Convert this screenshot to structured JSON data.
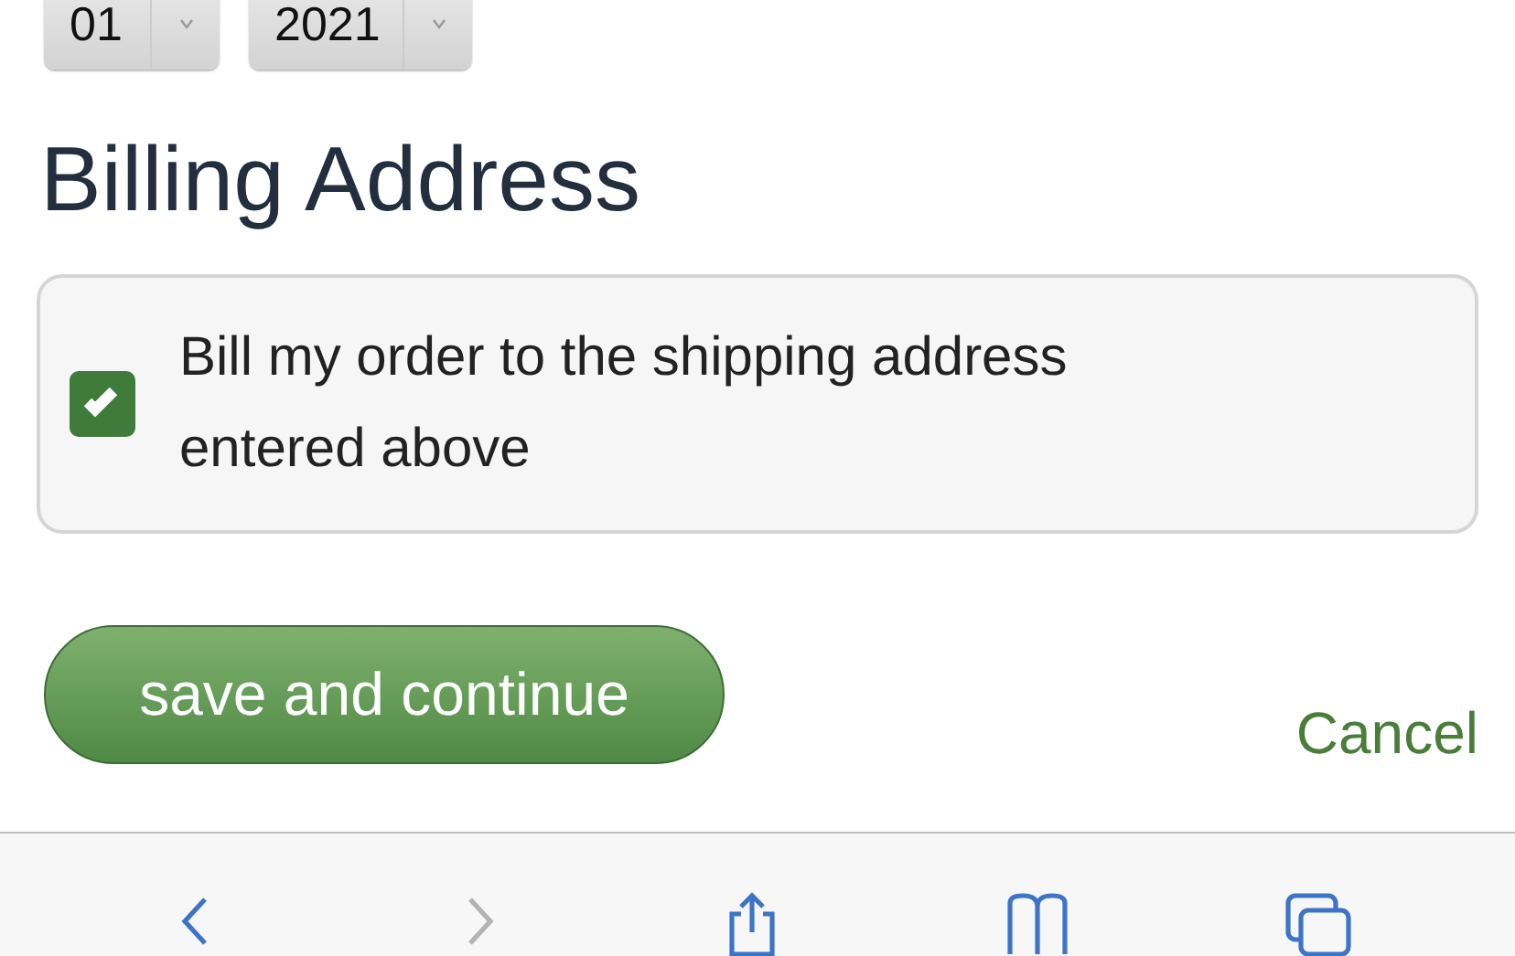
{
  "date_selects": [
    {
      "value": "01"
    },
    {
      "value": "2021"
    }
  ],
  "section_title": "Billing Address",
  "billing_option": {
    "label": "Bill my order to the shipping address entered above",
    "checked": true
  },
  "primary_button": "save and continue",
  "cancel_link": "Cancel",
  "toolbar": [
    {
      "kind": "back",
      "disabled": false
    },
    {
      "kind": "forward",
      "disabled": true
    },
    {
      "kind": "share",
      "disabled": false
    },
    {
      "kind": "bookmarks",
      "disabled": false
    },
    {
      "kind": "tabs",
      "disabled": false
    }
  ]
}
